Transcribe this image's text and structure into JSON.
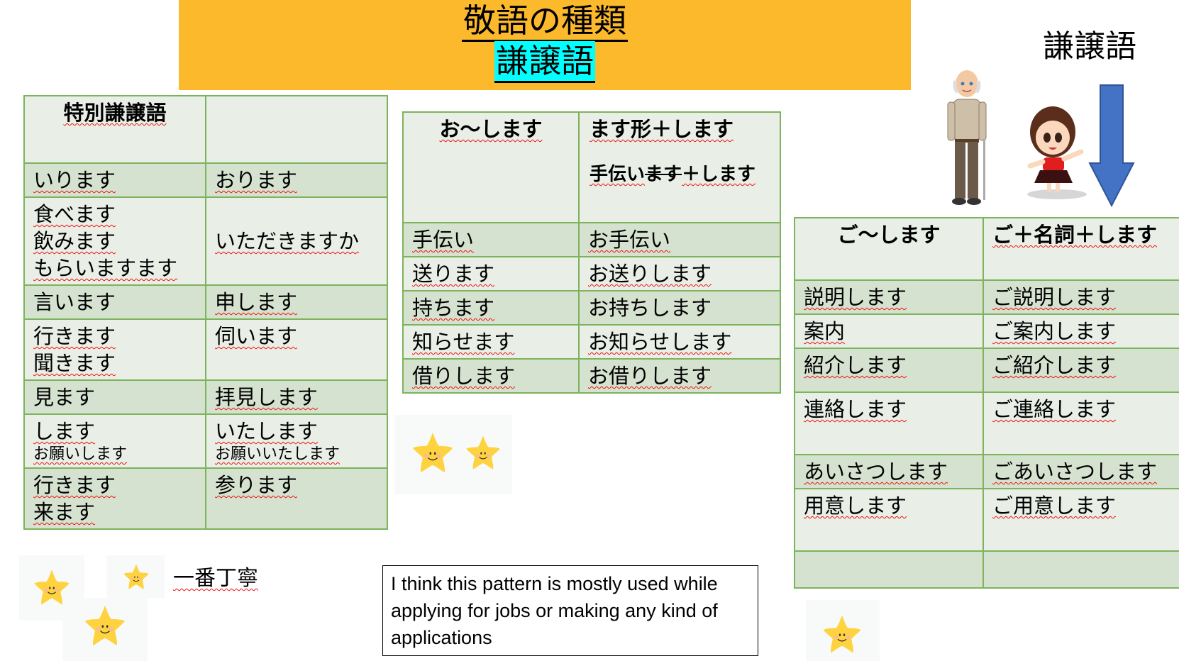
{
  "header": {
    "title": "敬語の種類",
    "subtitle": "謙譲語",
    "side_title": "謙譲語",
    "banner_color": "#fdb92c",
    "subtitle_highlight": "#00ffff"
  },
  "table_special": {
    "header": [
      "特別謙譲語",
      ""
    ],
    "rows": [
      {
        "left": [
          "いります"
        ],
        "right": [
          "おります"
        ]
      },
      {
        "left": [
          "食べます",
          "飲みます",
          "もらいますます"
        ],
        "right": [
          "いただきますか"
        ]
      },
      {
        "left": [
          "言います"
        ],
        "right": [
          "申します"
        ]
      },
      {
        "left": [
          "行きます",
          "聞きます"
        ],
        "right": [
          "伺います"
        ]
      },
      {
        "left": [
          "見ます"
        ],
        "right": [
          "拝見します"
        ]
      },
      {
        "left": [
          "します"
        ],
        "left_small": "お願いします",
        "right": [
          "いたします"
        ],
        "right_small": "お願いいたします"
      },
      {
        "left": [
          "行きます",
          "来ます"
        ],
        "right": [
          "参ります"
        ]
      }
    ]
  },
  "table_o": {
    "header": [
      "お～します",
      "ます形＋します"
    ],
    "example": {
      "stem": "手伝い",
      "struck": "ます",
      "rest": "＋します"
    },
    "rows": [
      [
        "手伝い",
        "お手伝い"
      ],
      [
        "送ります",
        "お送りします"
      ],
      [
        "持ちます",
        "お持ちします"
      ],
      [
        "知らせます",
        "お知らせします"
      ],
      [
        "借りします",
        "お借りします"
      ]
    ]
  },
  "table_go": {
    "header": [
      "ご～します",
      "ご＋名詞＋します"
    ],
    "rows": [
      [
        "説明します",
        "ご説明します"
      ],
      [
        "案内",
        "ご案内します"
      ],
      [
        "紹介します",
        "ご紹介します"
      ],
      [
        "連絡します",
        "ご連絡します"
      ],
      [
        "あいさつします",
        "ごあいさつします"
      ],
      [
        "用意します",
        "ご用意します"
      ],
      [
        "",
        ""
      ]
    ]
  },
  "caption": "一番丁寧",
  "note": "I think this pattern is mostly used while applying for jobs or making any kind of applications",
  "colors": {
    "table_border": "#7cb35c",
    "row_light": "#e9efe7",
    "row_dark": "#d6e2d0",
    "arrow": "#4472c4",
    "star": "#ffd23f"
  },
  "icons": [
    "smiling-star-icon",
    "old-man-figure",
    "girl-figure",
    "down-arrow-icon"
  ]
}
